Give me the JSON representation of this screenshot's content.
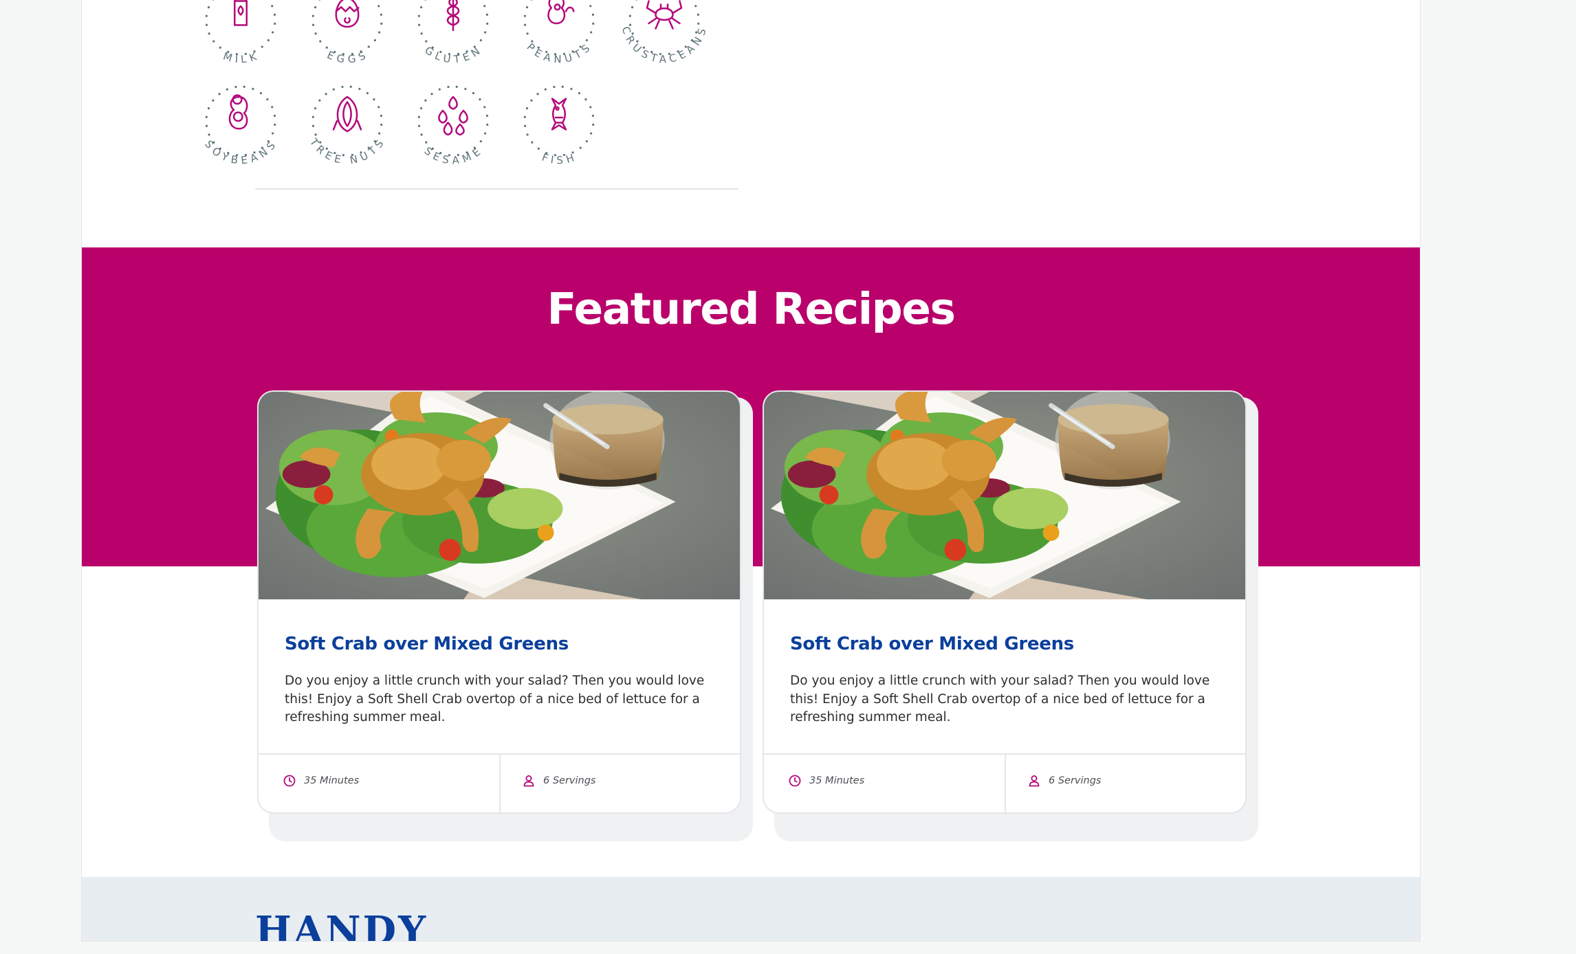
{
  "colors": {
    "brand": "#b9006b",
    "title_blue": "#0b3f9c",
    "icon_magenta": "#b4087b",
    "text_gray": "#5d7377"
  },
  "allergens": [
    {
      "label": "MILK",
      "icon": "milk-carton-icon"
    },
    {
      "label": "EGGS",
      "icon": "egg-icon"
    },
    {
      "label": "GLUTEN",
      "icon": "wheat-icon"
    },
    {
      "label": "PEANUTS",
      "icon": "peanut-icon"
    },
    {
      "label": "CRUSTACEANS",
      "icon": "crab-icon"
    },
    {
      "label": "SOYBEANS",
      "icon": "soybean-icon"
    },
    {
      "label": "TREE NUTS",
      "icon": "almond-icon"
    },
    {
      "label": "SESAME",
      "icon": "sesame-seeds-icon"
    },
    {
      "label": "FISH",
      "icon": "fish-icon"
    }
  ],
  "featured": {
    "title": "Featured Recipes",
    "recipes": [
      {
        "title": "Soft Crab over Mixed Greens",
        "description": "Do you enjoy a little crunch with your salad? Then you would love this! Enjoy a Soft Shell Crab overtop of a nice bed of lettuce for a refreshing summer meal.",
        "time": "35 Minutes",
        "servings": "6 Servings"
      },
      {
        "title": "Soft Crab over Mixed Greens",
        "description": "Do you enjoy a little crunch with your salad? Then you would love this! Enjoy a Soft Shell Crab overtop of a nice bed of lettuce for a refreshing summer meal.",
        "time": "35 Minutes",
        "servings": "6 Servings"
      }
    ]
  },
  "footer": {
    "logo_text": "HANDY"
  }
}
